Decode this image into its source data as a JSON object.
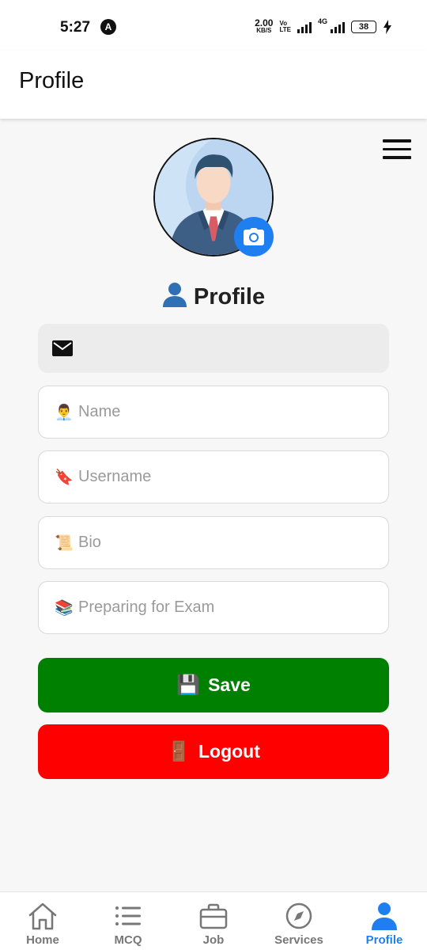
{
  "status_bar": {
    "time": "5:27",
    "app_icon_letter": "A",
    "net_speed_value": "2.00",
    "net_speed_unit": "KB/S",
    "volte_top": "Vo",
    "volte_bottom": "LTE",
    "network_type": "4G",
    "battery": "38"
  },
  "header": {
    "title": "Profile"
  },
  "profile": {
    "heading": "Profile",
    "avatar_icon": "user-avatar-icon",
    "camera_icon": "camera-icon"
  },
  "form": {
    "email": {
      "icon": "mail-icon",
      "value": ""
    },
    "name": {
      "emoji": "👨‍💼",
      "placeholder": "Name"
    },
    "username": {
      "emoji": "🔖",
      "placeholder": "Username"
    },
    "bio": {
      "emoji": "📜",
      "placeholder": "Bio"
    },
    "exam": {
      "emoji": "📚",
      "placeholder": "Preparing for Exam"
    }
  },
  "buttons": {
    "save": {
      "emoji": "💾",
      "label": "Save",
      "color": "#008000"
    },
    "logout": {
      "emoji": "🚪",
      "label": "Logout",
      "color": "#ff0000"
    }
  },
  "bottom_nav": {
    "items": [
      {
        "label": "Home",
        "icon": "home-icon"
      },
      {
        "label": "MCQ",
        "icon": "list-icon"
      },
      {
        "label": "Job",
        "icon": "briefcase-icon"
      },
      {
        "label": "Services",
        "icon": "compass-icon"
      },
      {
        "label": "Profile",
        "icon": "person-icon"
      }
    ],
    "active_index": 4,
    "active_color": "#1f7ff0",
    "inactive_color": "#777777"
  }
}
